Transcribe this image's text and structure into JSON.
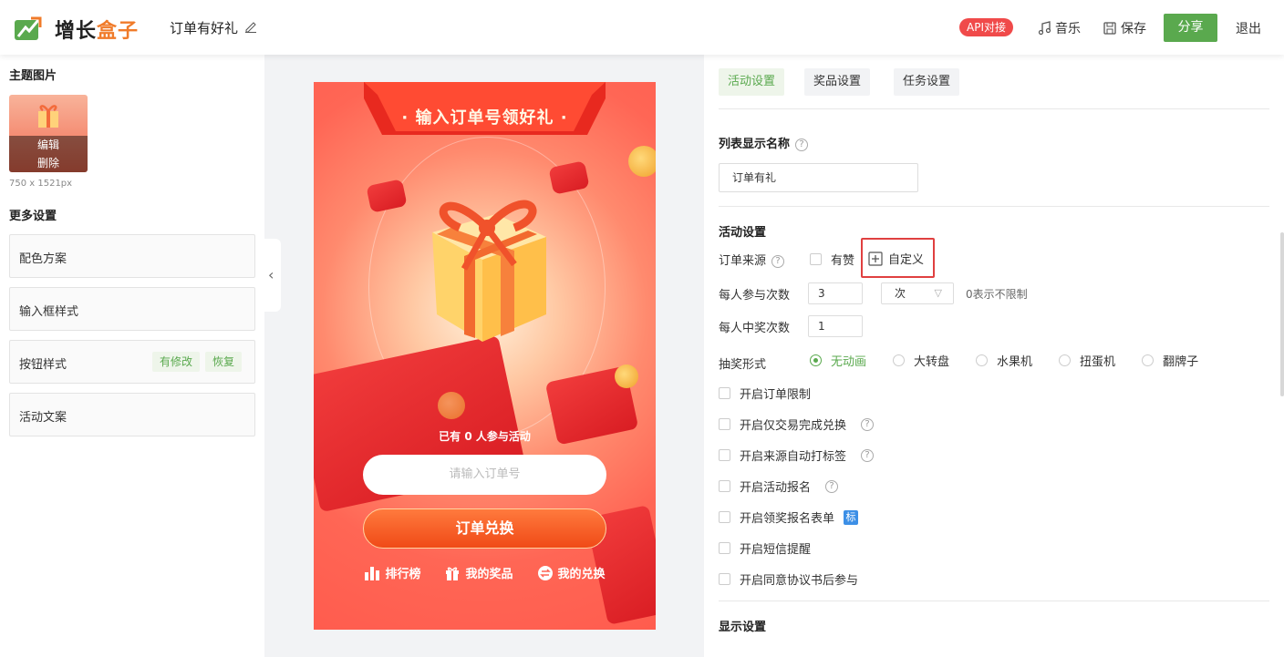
{
  "header": {
    "brand_part1": "增长",
    "brand_part2": "盒子",
    "doc_title": "订单有好礼",
    "api_badge": "API对接",
    "music": "音乐",
    "save": "保存",
    "share": "分享",
    "exit": "退出",
    "colors": {
      "accent": "#5aa94e",
      "brand_orange": "#f07b2a",
      "badge_red": "#f04a4a"
    }
  },
  "left": {
    "theme_image_title": "主题图片",
    "edit": "编辑",
    "delete": "删除",
    "image_size": "750 x 1521px",
    "more_settings_title": "更多设置",
    "options": [
      {
        "label": "配色方案"
      },
      {
        "label": "输入框样式"
      },
      {
        "label": "按钮样式",
        "tag_modified": "有修改",
        "tag_restore": "恢复"
      },
      {
        "label": "活动文案"
      }
    ]
  },
  "preview": {
    "banner_title": "· 输入订单号领好礼 ·",
    "participants": "已有 0 人参与活动",
    "input_placeholder": "请输入订单号",
    "redeem_button": "订单兑换",
    "links": [
      "排行榜",
      "我的奖品",
      "我的兑换"
    ]
  },
  "right": {
    "tabs": [
      "活动设置",
      "奖品设置",
      "任务设置"
    ],
    "list_name_label": "列表显示名称",
    "list_name_value": "订单有礼",
    "activity_settings_title": "活动设置",
    "order_source_label": "订单来源",
    "order_source_option": "有赞",
    "custom_button": "自定义",
    "per_person_times_label": "每人参与次数",
    "per_person_times_value": "3",
    "per_person_unit": "次",
    "unlimited_hint": "0表示不限制",
    "per_person_win_label": "每人中奖次数",
    "per_person_win_value": "1",
    "draw_mode_label": "抽奖形式",
    "draw_modes": [
      "无动画",
      "大转盘",
      "水果机",
      "扭蛋机",
      "翻牌子"
    ],
    "draw_mode_selected": "无动画",
    "checkboxes": [
      "开启订单限制",
      "开启仅交易完成兑换",
      "开启来源自动打标签",
      "开启活动报名",
      "开启领奖报名表单",
      "开启短信提醒",
      "开启同意协议书后参与"
    ],
    "form_tag": "标",
    "display_settings_title": "显示设置"
  }
}
